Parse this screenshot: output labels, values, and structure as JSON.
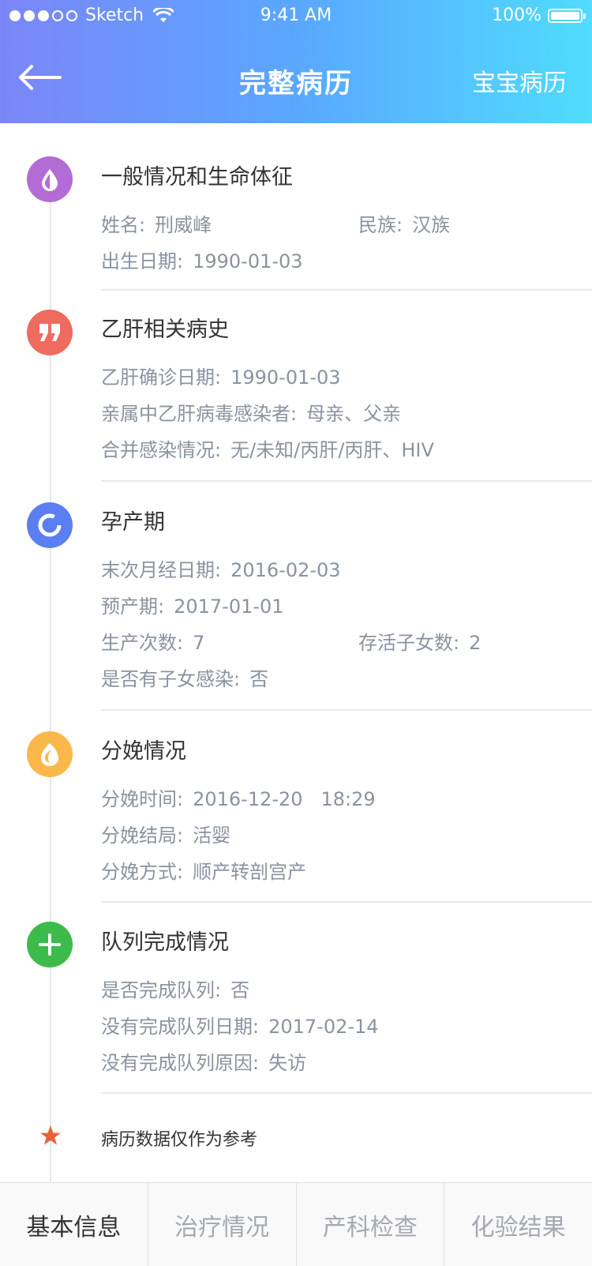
{
  "status_bar": {
    "carrier": "Sketch",
    "time": "9:41 AM",
    "battery": "100%"
  },
  "nav": {
    "title": "完整病历",
    "right_label": "宝宝病历"
  },
  "sections": [
    {
      "title": "一般情况和生命体征",
      "icon": "drop-icon",
      "color": "#b36bd5",
      "fields": [
        {
          "label": "姓名:",
          "value": "刑威峰"
        },
        {
          "label": "民族:",
          "value": "汉族"
        },
        {
          "label": "出生日期:",
          "value": "1990-01-03"
        }
      ]
    },
    {
      "title": "乙肝相关病史",
      "icon": "quote-icon",
      "color": "#ef6a5f",
      "fields": [
        {
          "label": "乙肝确诊日期:",
          "value": "1990-01-03"
        },
        {
          "label": "亲属中乙肝病毒感染者:",
          "value": "母亲、父亲"
        },
        {
          "label": "合并感染情况:",
          "value": "无/未知/丙肝/丙肝、HIV"
        }
      ]
    },
    {
      "title": "孕产期",
      "icon": "ring-icon",
      "color": "#5b7ff2",
      "fields": [
        {
          "label": "末次月经日期:",
          "value": "2016-02-03"
        },
        {
          "label": "预产期:",
          "value": "2017-01-01"
        },
        {
          "label": "生产次数:",
          "value": "7"
        },
        {
          "label": "存活子女数:",
          "value": "2"
        },
        {
          "label": "是否有子女感染:",
          "value": "否"
        }
      ]
    },
    {
      "title": "分娩情况",
      "icon": "egg-icon",
      "color": "#fbb84a",
      "fields": [
        {
          "label": "分娩时间:",
          "value": "2016-12-20   18:29"
        },
        {
          "label": "分娩结局:",
          "value": "活婴"
        },
        {
          "label": "分娩方式:",
          "value": "顺产转剖宫产"
        }
      ]
    },
    {
      "title": "队列完成情况",
      "icon": "plus-icon",
      "color": "#3dbb4a",
      "fields": [
        {
          "label": "是否完成队列:",
          "value": "否"
        },
        {
          "label": "没有完成队列日期:",
          "value": "2017-02-14"
        },
        {
          "label": "没有完成队列原因:",
          "value": "失访"
        }
      ]
    }
  ],
  "note": "病历数据仅作为参考",
  "star_color": "#e8613a",
  "tabs": [
    {
      "label": "基本信息",
      "active": true
    },
    {
      "label": "治疗情况",
      "active": false
    },
    {
      "label": "产科检查",
      "active": false
    },
    {
      "label": "化验结果",
      "active": false
    }
  ]
}
